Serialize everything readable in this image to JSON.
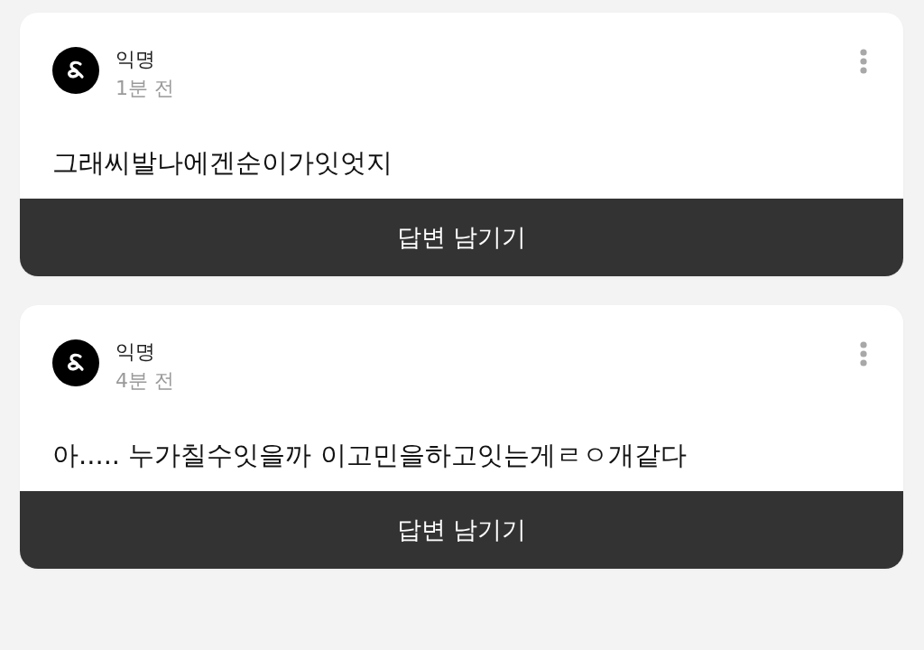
{
  "posts": [
    {
      "author": "익명",
      "time": "1분 전",
      "body": "그래씨발나에겐순이가잇엇지",
      "reply_button": "답변 남기기"
    },
    {
      "author": "익명",
      "time": "4분 전",
      "body": "아..... 누가칠수잇을까 이고민을하고잇는게ㄹㅇ개같다",
      "reply_button": "답변 남기기"
    }
  ]
}
